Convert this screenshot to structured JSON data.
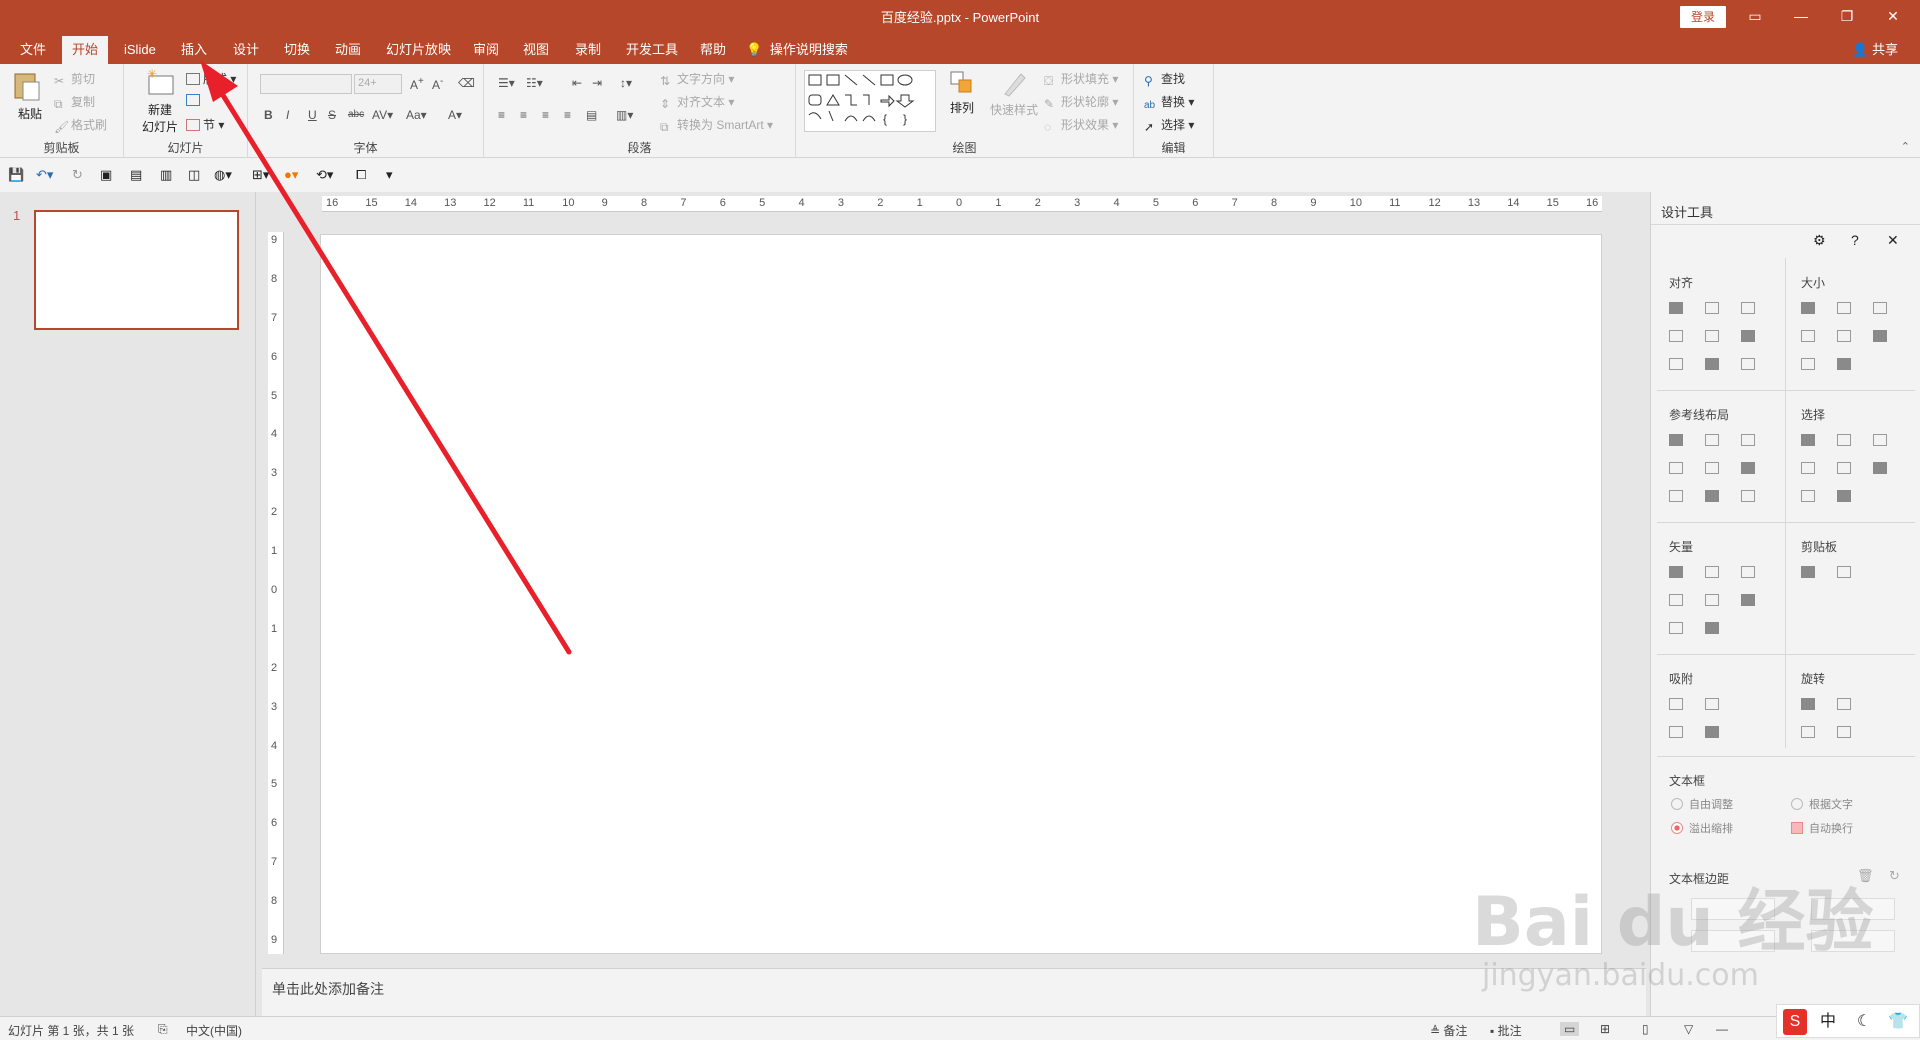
{
  "app": {
    "title": "百度经验.pptx  -  PowerPoint",
    "login": "登录",
    "share": "共享"
  },
  "tabs": [
    "文件",
    "开始",
    "iSlide",
    "插入",
    "设计",
    "切换",
    "动画",
    "幻灯片放映",
    "审阅",
    "视图",
    "录制",
    "开发工具",
    "帮助"
  ],
  "tell_me": "操作说明搜索",
  "ribbon": {
    "clipboard": {
      "label": "剪贴板",
      "paste": "粘贴",
      "cut": "剪切",
      "copy": "复制",
      "format_painter": "格式刷"
    },
    "slides": {
      "label": "幻灯片",
      "new_slide_1": "新建",
      "new_slide_2": "幻灯片",
      "layout": "版式",
      "section": "节"
    },
    "font": {
      "label": "字体",
      "size": "24+"
    },
    "paragraph": {
      "label": "段落",
      "text_direction": "文字方向",
      "align_text": "对齐文本",
      "smartart": "转换为 SmartArt"
    },
    "drawing": {
      "label": "绘图",
      "arrange": "排列",
      "quick_styles": "快速样式",
      "shape_fill": "形状填充",
      "shape_outline": "形状轮廓",
      "shape_effects": "形状效果"
    },
    "editing": {
      "label": "编辑",
      "find": "查找",
      "replace": "替换",
      "select": "选择"
    }
  },
  "ruler": {
    "h_ticks": [
      "16",
      "15",
      "14",
      "13",
      "12",
      "11",
      "10",
      "9",
      "8",
      "7",
      "6",
      "5",
      "4",
      "3",
      "2",
      "1",
      "0",
      "1",
      "2",
      "3",
      "4",
      "5",
      "6",
      "7",
      "8",
      "9",
      "10",
      "11",
      "12",
      "13",
      "14",
      "15",
      "16"
    ],
    "v_ticks": [
      "9",
      "8",
      "7",
      "6",
      "5",
      "4",
      "3",
      "2",
      "1",
      "0",
      "1",
      "2",
      "3",
      "4",
      "5",
      "6",
      "7",
      "8",
      "9"
    ]
  },
  "thumbnails": {
    "num": "1"
  },
  "notes": {
    "placeholder": "单击此处添加备注"
  },
  "design_pane": {
    "title": "设计工具",
    "sections": {
      "align": "对齐",
      "size": "大小",
      "guides": "参考线布局",
      "select": "选择",
      "vector": "矢量",
      "clipboard": "剪贴板",
      "snap": "吸附",
      "rotate": "旋转",
      "textbox": "文本框",
      "margins": "文本框边距"
    },
    "options": {
      "auto_fit": "自由调整",
      "fit_text": "根据文字",
      "shrink": "溢出缩排",
      "wrap": "自动换行"
    }
  },
  "status": {
    "slide_info": "幻灯片 第 1 张，共 1 张",
    "language": "中文(中国)",
    "notes": "备注",
    "comments": "批注"
  },
  "ime": {
    "cn": "中"
  },
  "watermark": {
    "main": "Bai du 经验",
    "sub": "jingyan.baidu.com"
  },
  "colors": {
    "accent": "#b7472a",
    "arrow": "#e8202a"
  }
}
